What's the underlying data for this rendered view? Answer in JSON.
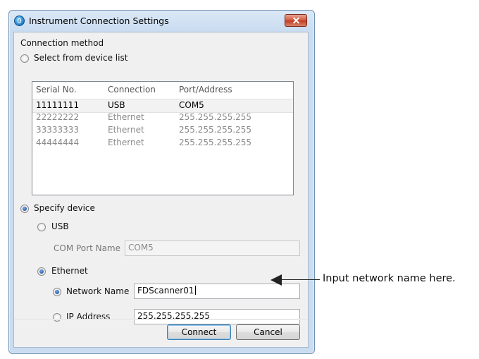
{
  "window": {
    "title": "Instrument Connection Settings"
  },
  "connection_method": {
    "heading": "Connection method",
    "select_from_list_label": "Select from device list",
    "specify_device_label": "Specify device"
  },
  "device_list": {
    "columns": [
      "Serial No.",
      "Connection",
      "Port/Address"
    ],
    "rows": [
      [
        "11111111",
        "USB",
        "COM5"
      ],
      [
        "22222222",
        "Ethernet",
        "255.255.255.255"
      ],
      [
        "33333333",
        "Ethernet",
        "255.255.255.255"
      ],
      [
        "44444444",
        "Ethernet",
        "255.255.255.255"
      ]
    ]
  },
  "usb": {
    "label": "USB",
    "com_port_label": "COM Port Name",
    "com_port_value": "COM5"
  },
  "ethernet": {
    "label": "Ethernet",
    "network_name_label": "Network Name",
    "network_name_value": "FDScanner01",
    "ip_address_label": "IP Address",
    "ip_address_value": "255.255.255.255"
  },
  "buttons": {
    "connect": "Connect",
    "cancel": "Cancel"
  },
  "annotation": {
    "text": "Input network name here."
  },
  "colors": {
    "title_bar": "#c9dcf0",
    "close_button": "#c13a1f",
    "dialog_bg": "#f0f0f0"
  },
  "icons": {
    "app": "instrument-app-icon",
    "close": "close-icon"
  }
}
